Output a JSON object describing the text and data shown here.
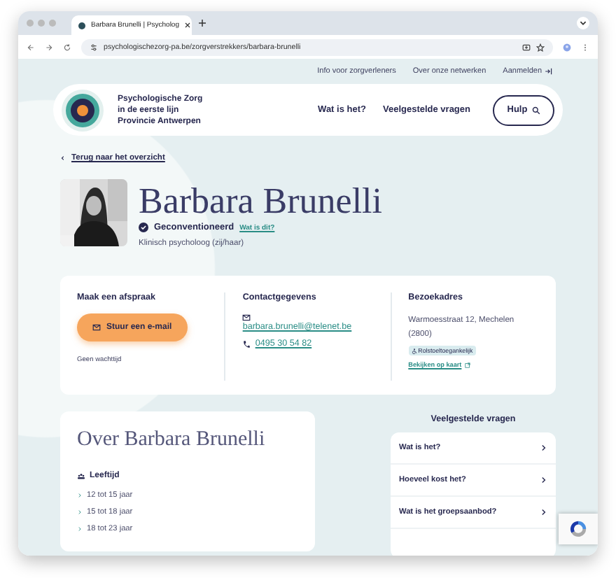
{
  "browser": {
    "tab_title": "Barbara Brunelli | Psycholog",
    "url": "psychologischezorg-pa.be/zorgverstrekkers/barbara-brunelli"
  },
  "top_links": [
    "Info voor zorgverleners",
    "Over onze netwerken",
    "Aanmelden"
  ],
  "logo_text": [
    "Psychologische Zorg",
    "in de eerste lijn",
    "Provincie Antwerpen"
  ],
  "nav": [
    "Wat is het?",
    "Veelgestelde vragen"
  ],
  "help_button": "Hulp",
  "back_link": "Terug naar het overzicht",
  "profile": {
    "name": "Barbara Brunelli",
    "badge": "Geconventioneerd",
    "badge_link": "Wat is dit?",
    "role": "Klinisch psycholoog (zij/haar)"
  },
  "appointment": {
    "title": "Maak een afspraak",
    "button": "Stuur een e-mail",
    "note": "Geen wachttijd"
  },
  "contact": {
    "title": "Contactgegevens",
    "email": "barbara.brunelli@telenet.be",
    "phone": "0495 30 54 82"
  },
  "address": {
    "title": "Bezoekadres",
    "text": "Warmoesstraat 12, Mechelen (2800)",
    "tag": "Rolstoeltoegankelijk",
    "map_link": "Bekijken op kaart"
  },
  "about": {
    "title": "Over Barbara Brunelli",
    "section": "Leeftijd",
    "items": [
      "12 tot 15 jaar",
      "15 tot 18 jaar",
      "18 tot 23 jaar"
    ]
  },
  "faq": {
    "title": "Veelgestelde vragen",
    "items": [
      "Wat is het?",
      "Hoeveel kost het?",
      "Wat is het groepsaanbod?"
    ]
  }
}
